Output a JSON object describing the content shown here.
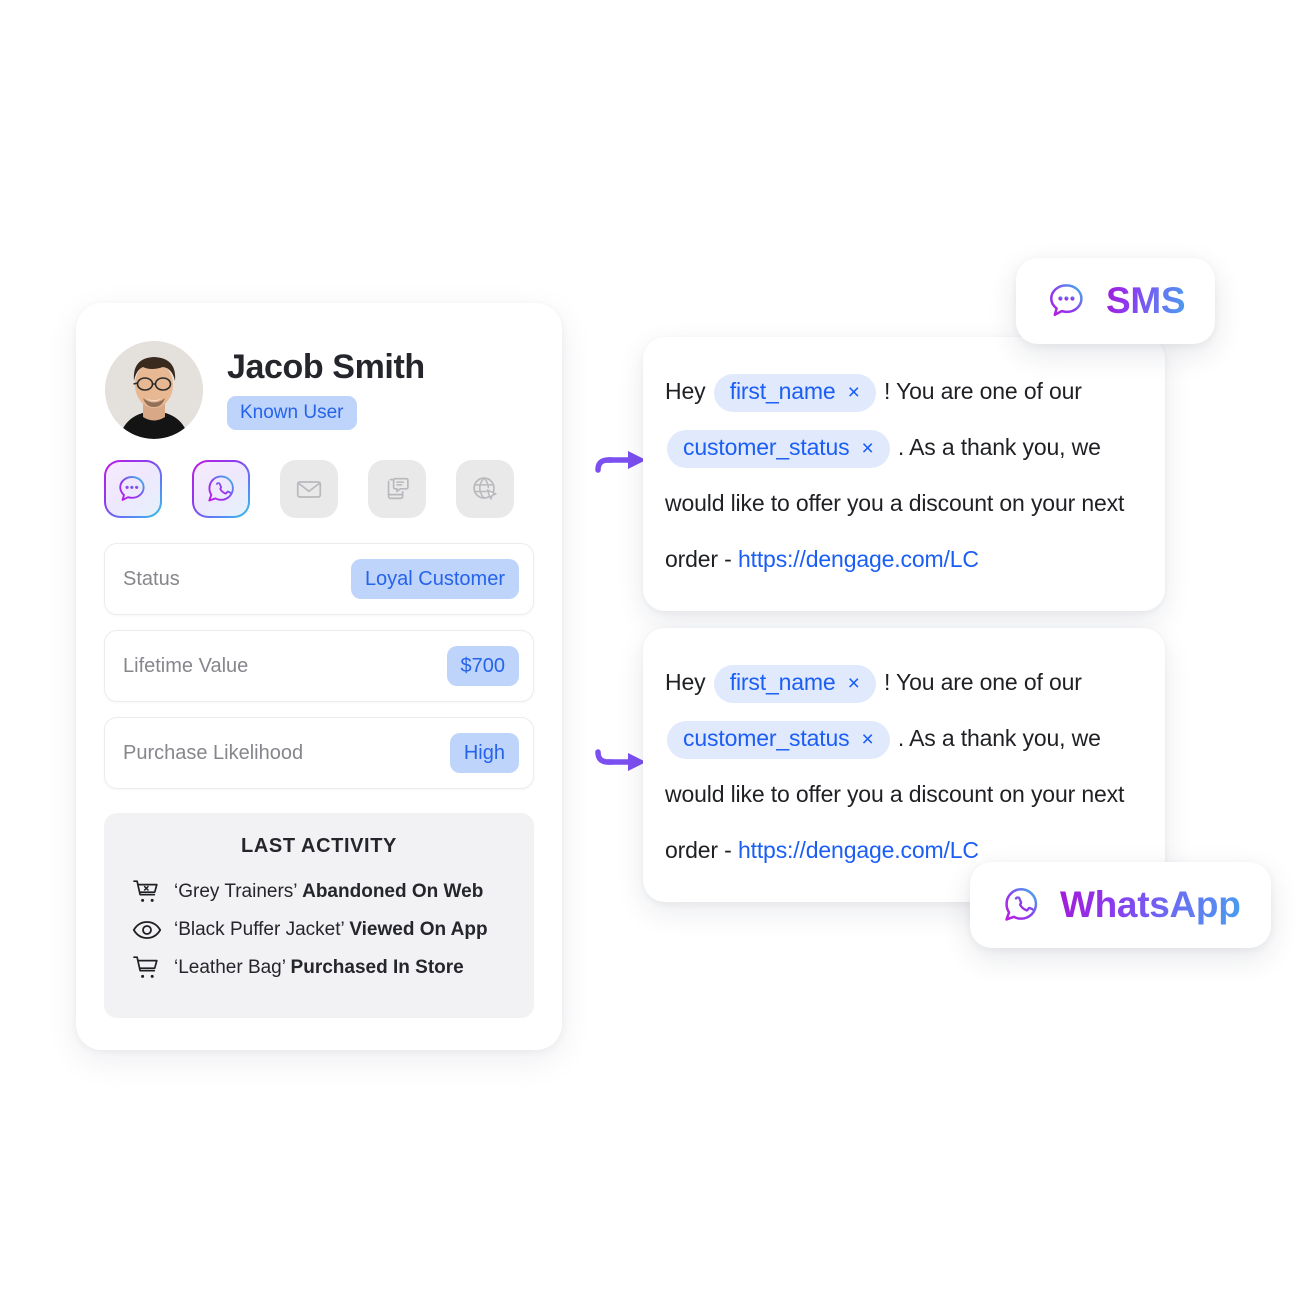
{
  "profile": {
    "name": "Jacob Smith",
    "badge": "Known User",
    "avatar_icon": "user-photo-avatar",
    "channels": [
      {
        "name": "sms",
        "icon": "sms-chat-bubble-icon",
        "active": true
      },
      {
        "name": "whatsapp",
        "icon": "whatsapp-icon",
        "active": true
      },
      {
        "name": "email",
        "icon": "envelope-icon",
        "active": false
      },
      {
        "name": "push",
        "icon": "mobile-push-icon",
        "active": false
      },
      {
        "name": "web",
        "icon": "globe-cursor-icon",
        "active": false
      }
    ],
    "attributes": [
      {
        "label": "Status",
        "value": "Loyal Customer"
      },
      {
        "label": "Lifetime Value",
        "value": "$700"
      },
      {
        "label": "Purchase Likelihood",
        "value": "High"
      }
    ],
    "activity": {
      "title": "LAST ACTIVITY",
      "items": [
        {
          "icon": "abandoned-cart-icon",
          "item": "‘Grey Trainers’",
          "action": "Abandoned On Web"
        },
        {
          "icon": "eye-icon",
          "item": "‘Black Puffer Jacket’",
          "action": "Viewed On App"
        },
        {
          "icon": "cart-icon",
          "item": "‘Leather Bag’",
          "action": "Purchased In Store"
        }
      ]
    }
  },
  "messages": [
    {
      "channel": "SMS",
      "greeting": "Hey",
      "token_1": "first_name",
      "token_1_remove": "×",
      "mid_1": "! You are one of our",
      "token_2": "customer_status",
      "token_2_remove": "×",
      "mid_2": ". As a thank you,",
      "line_3": "we would like to offer you a discount on",
      "line_4_prefix": "your next order - ",
      "link": "https://dengage.com/LC"
    },
    {
      "channel": "WhatsApp",
      "greeting": "Hey",
      "token_1": "first_name",
      "token_1_remove": "×",
      "mid_1": "! You are one of our",
      "token_2": "customer_status",
      "token_2_remove": "×",
      "mid_2": ". As a thank you,",
      "line_3": "we would like to offer you a discount on",
      "line_4_prefix": "your next order - ",
      "link": "https://dengage.com/LC"
    }
  ],
  "badges": [
    {
      "label": "SMS",
      "icon": "sms-chat-bubble-icon"
    },
    {
      "label": "WhatsApp",
      "icon": "whatsapp-icon"
    }
  ],
  "colors": {
    "accent_blue": "#1b5ef5",
    "token_bg": "#e1e9fd",
    "badge_bg": "#bed4fb",
    "gradient_start": "#a21cd8",
    "gradient_end": "#4a9ef0",
    "connector_purple": "#7c4ff0",
    "connector_blue": "#4a9ef0",
    "activity_bg": "#f2f2f4"
  }
}
